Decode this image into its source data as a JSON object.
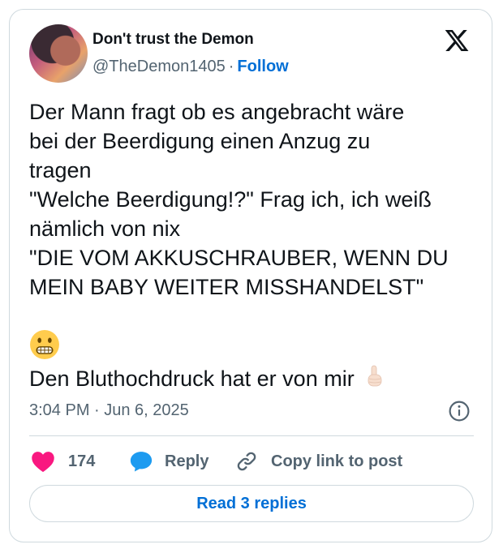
{
  "author": {
    "display_name": "Don't trust the Demon",
    "handle": "@TheDemon1405",
    "separator": "·",
    "follow_label": "Follow"
  },
  "tweet": {
    "text": "Der Mann fragt ob es angebracht wäre\nbei der Beerdigung einen Anzug zu\ntragen\n\"Welche Beerdigung!?\" Frag ich, ich weiß\nnämlich von nix\n\"DIE VOM AKKUSCHRAUBER, WENN DU\nMEIN BABY WEITER MISSHANDELST\"",
    "emoji_line": "grimacing-face-emoji",
    "last_line": "Den Bluthochdruck hat er von mir",
    "timestamp": "3:04 PM · Jun 6, 2025"
  },
  "actions": {
    "like_count": "174",
    "reply_label": "Reply",
    "copy_link_label": "Copy link to post"
  },
  "read_replies_label": "Read 3 replies",
  "colors": {
    "like": "#f91880",
    "link_blue": "#006fd6",
    "reply_icon": "#1d9bf0",
    "muted": "#536471"
  }
}
